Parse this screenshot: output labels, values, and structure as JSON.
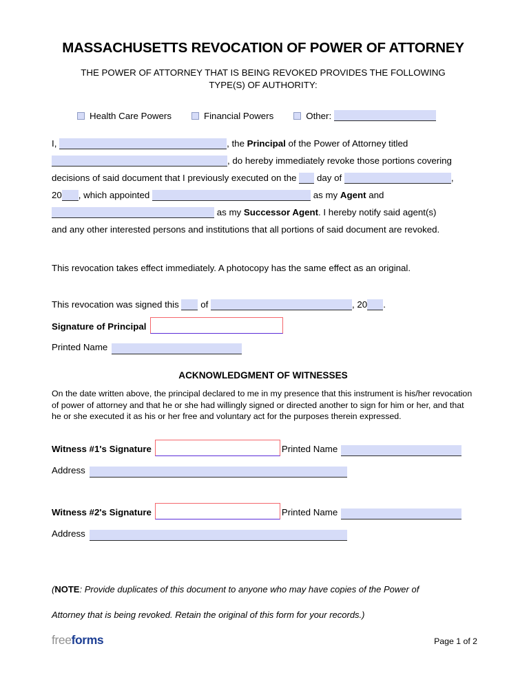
{
  "document": {
    "title": "MASSACHUSETTS REVOCATION OF POWER OF ATTORNEY",
    "subtitle": "THE POWER OF ATTORNEY THAT IS BEING REVOKED PROVIDES THE FOLLOWING TYPE(S) OF AUTHORITY:"
  },
  "authority_types": {
    "options": [
      {
        "label": "Health Care Powers",
        "checked": false
      },
      {
        "label": "Financial Powers",
        "checked": false
      },
      {
        "label": "Other:",
        "checked": false
      }
    ],
    "other_value": ""
  },
  "body": {
    "l1_pre": "I,",
    "principal_name": "",
    "l1_post": ", the",
    "l1_bold": "Principal",
    "l1_tail": "of the Power of Attorney titled",
    "poa_title": "",
    "l2_post": ", do hereby immediately revoke those portions covering",
    "l3_pre": "decisions of said document that I previously executed on the",
    "day_value": "",
    "l3_mid": "day of",
    "month_value": "",
    "l3_comma": ",",
    "l4_year_prefix": "20",
    "year_value": "",
    "l4_mid": ", which appointed",
    "agent_name": "",
    "l4_tail_pre": "as my",
    "l4_bold": "Agent",
    "l4_tail": "and",
    "successor_name": "",
    "l5_pre": "as my",
    "l5_bold": "Successor Agent",
    "l5_post": ". I hereby notify said agent(s)",
    "l6": "and any other interested persons and institutions that all portions of said document are revoked."
  },
  "effect_text": "This revocation takes effect immediately. A photocopy has the same effect as an original.",
  "signed": {
    "pre": "This revocation was signed this",
    "day_value": "",
    "mid": "of",
    "month_value": "",
    "comma": ",",
    "year_prefix": "20",
    "year_value": "",
    "period": "."
  },
  "principal_signature": {
    "label": "Signature of Principal",
    "value": "",
    "printed_name_label": "Printed Name",
    "printed_name_value": ""
  },
  "acknowledgment": {
    "heading": "ACKNOWLEDGMENT OF WITNESSES",
    "text": "On the date written above, the principal declared to me in my presence that this instrument is his/her revocation of power of attorney and that he or she had willingly signed or directed another to sign for him or her, and that he or she executed it as his or her free and voluntary act for the purposes therein expressed."
  },
  "witnesses": [
    {
      "signature_label": "Witness #1's Signature",
      "signature_value": "",
      "printed_name_label": "Printed Name",
      "printed_name_value": "",
      "address_label": "Address",
      "address_value": ""
    },
    {
      "signature_label": "Witness #2's Signature",
      "signature_value": "",
      "printed_name_label": "Printed Name",
      "printed_name_value": "",
      "address_label": "Address",
      "address_value": ""
    }
  ],
  "note": {
    "open_paren": "(",
    "bold": "NOTE",
    "line1": ": Provide duplicates of this document to anyone who may have copies of the Power of",
    "line2": "Attorney that is being revoked. Retain the original of this form for your records.)"
  },
  "footer": {
    "logo_part1": "free",
    "logo_part2": "forms",
    "page_label": "Page 1 of 2"
  },
  "colors": {
    "field_fill": "#d6dcf8",
    "field_underline": "#2b2b2b",
    "signature_border": "#f4666b",
    "signature_bottom": "#5a2bd8",
    "checkbox_border": "#8e9bc4",
    "logo_gray": "#8f8f8f",
    "logo_blue": "#1d3f94"
  }
}
